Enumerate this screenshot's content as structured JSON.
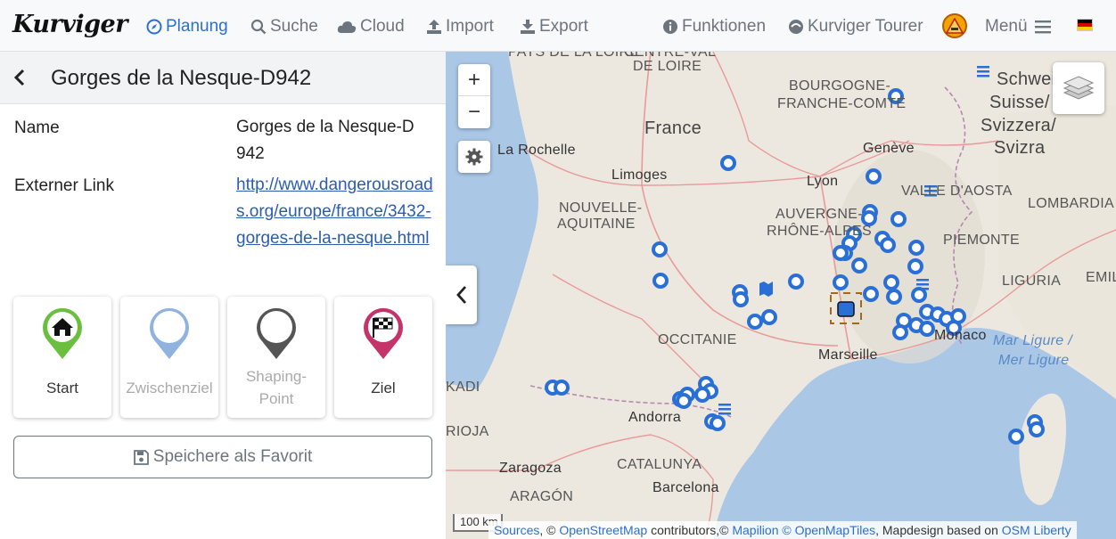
{
  "navbar": {
    "logo": "Kurviger",
    "items": [
      {
        "label": "Planung",
        "icon": "compass-icon",
        "active": true
      },
      {
        "label": "Suche",
        "icon": "search-icon"
      },
      {
        "label": "Cloud",
        "icon": "cloud-icon"
      },
      {
        "label": "Import",
        "icon": "upload-icon"
      },
      {
        "label": "Export",
        "icon": "download-icon"
      },
      {
        "label": "Funktionen",
        "icon": "info-icon"
      },
      {
        "label": "Kurviger Tourer",
        "icon": "tourer-icon"
      },
      {
        "label": "Menü",
        "icon": "hamburger-icon"
      }
    ],
    "language_flag": "de-flag-icon"
  },
  "panel": {
    "title": "Gorges de la Nesque-D942",
    "name_label": "Name",
    "name_value": "Gorges de la Nesque-D942",
    "link_label": "Externer Link",
    "link_value": "http://www.dangerousroads.org/europe/france/3432-gorges-de-la-nesque.html",
    "waypoints": [
      {
        "label": "Start",
        "color": "#6abf3f"
      },
      {
        "label": "Zwischenziel",
        "color": "#8fb2e0"
      },
      {
        "label": "Shaping-Point",
        "color": "#555555"
      },
      {
        "label": "Ziel",
        "color": "#c4336a"
      }
    ],
    "favorite_button": "Speichere als Favorit"
  },
  "map": {
    "zoom_in": "+",
    "zoom_out": "−",
    "scale_label": "100 km",
    "attribution": {
      "sources": "Sources",
      "sep1": ", ©",
      "osm": "OpenStreetMap",
      "contributors": "contributors,©",
      "mapilion": "Mapilion",
      "omt": "© OpenMapTiles",
      "mapdesign": ", Mapdesign based on",
      "osm_liberty": "OSM Liberty"
    },
    "labels": {
      "pays_loire": "PAYS DE LA LOIRE",
      "centre": "CENTRE-VAL",
      "de_loire": "DE LOIRE",
      "bourgogne": "BOURGOGNE-",
      "franche": "FRANCHE-COMTÉ",
      "france": "France",
      "la_rochelle": "La Rochelle",
      "limoges": "Limoges",
      "geneve": "Genève",
      "lyon": "Lyon",
      "nouvelle": "NOUVELLE-",
      "aquitaine": "AQUITAINE",
      "auvergne": "AUVERGNE-",
      "rhone": "RHÔNE-ALPES",
      "vallee": "VALLE D'AOSTA",
      "lombardia": "LOMBARDIA",
      "piemonte": "PIEMONTE",
      "liguria": "LIGURIA",
      "emilia": "EMILIA",
      "schweiz": "Schweiz/",
      "suisse": "Suisse/",
      "svizzera": "Svizzera/",
      "svizra": "Svizra",
      "occitanie": "OCCITANIE",
      "marseille": "Marseille",
      "monaco": "Monaco",
      "mar_ligure": "Mar Ligure /",
      "mer_ligure": "Mer Ligure",
      "kadi": "KADI",
      "andorra": "Andorra",
      "rioja": "RIOJA",
      "zaragoza": "Zaragoza",
      "catalunya": "CATALUNYA",
      "aragon": "ARAGÓN",
      "barcelona": "Barcelona"
    }
  }
}
